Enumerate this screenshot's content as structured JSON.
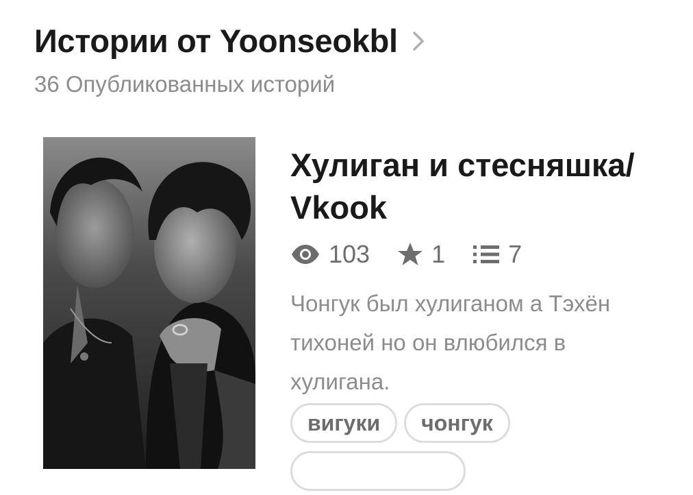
{
  "header": {
    "title": "Истории от Yoonseokbl",
    "published_count": "36 Опубликованных историй"
  },
  "story": {
    "title": "Хулиган и стесняшка/ Vkook",
    "stats": {
      "views": "103",
      "votes": "1",
      "parts": "7"
    },
    "description": "Чонгук был хулиганом а Тэхён тихоней но он влюбился в хулигана.",
    "tags": [
      "вигуки",
      "чонгук"
    ],
    "cover_alt": "Обложка истории"
  },
  "colors": {
    "title": "#1a1a1a",
    "muted_text": "#8c8c8c",
    "stats_text": "#6d6d6d",
    "tag_border": "#dcdcdc"
  },
  "icons": {
    "header_chevron": "chevron-right-icon",
    "views": "eye-icon",
    "votes": "star-icon",
    "parts": "list-icon"
  }
}
